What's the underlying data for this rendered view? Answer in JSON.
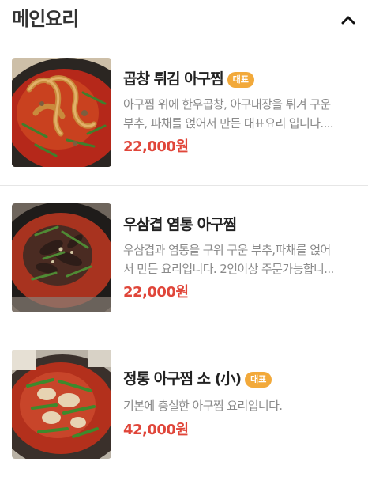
{
  "section": {
    "title": "메인요리",
    "toggle_icon": "chevron-up-icon"
  },
  "items": [
    {
      "name": "곱창 튀김 아구찜",
      "badge": "대표",
      "desc_lines": [
        "아구찜 위에 한우곱창, 아구내장을 튀겨 구운",
        "부추, 파채를 얹어서 만든 대표요리 입니다...."
      ],
      "price": "22,000원",
      "image": "fried-gopchang-agujjim-photo"
    },
    {
      "name": "우삼겹 염통 아구찜",
      "desc_lines": [
        "우삼겹과 염통을 구워 구운 부추,파채를 얹어",
        "서 만든 요리입니다. 2인이상 주문가능합니..."
      ],
      "price": "22,000원",
      "image": "beef-brisket-heart-agujjim-photo"
    },
    {
      "name": "정통 아구찜 소 (小)",
      "badge": "대표",
      "desc_lines": [
        "기본에 충실한 아구찜 요리입니다."
      ],
      "price": "42,000원",
      "image": "traditional-agujjim-small-photo"
    }
  ],
  "colors": {
    "price": "#e0463a",
    "badge": "#f2a93a",
    "title": "#222222",
    "description": "#8a8a8a",
    "divider": "#e6e6e6"
  }
}
